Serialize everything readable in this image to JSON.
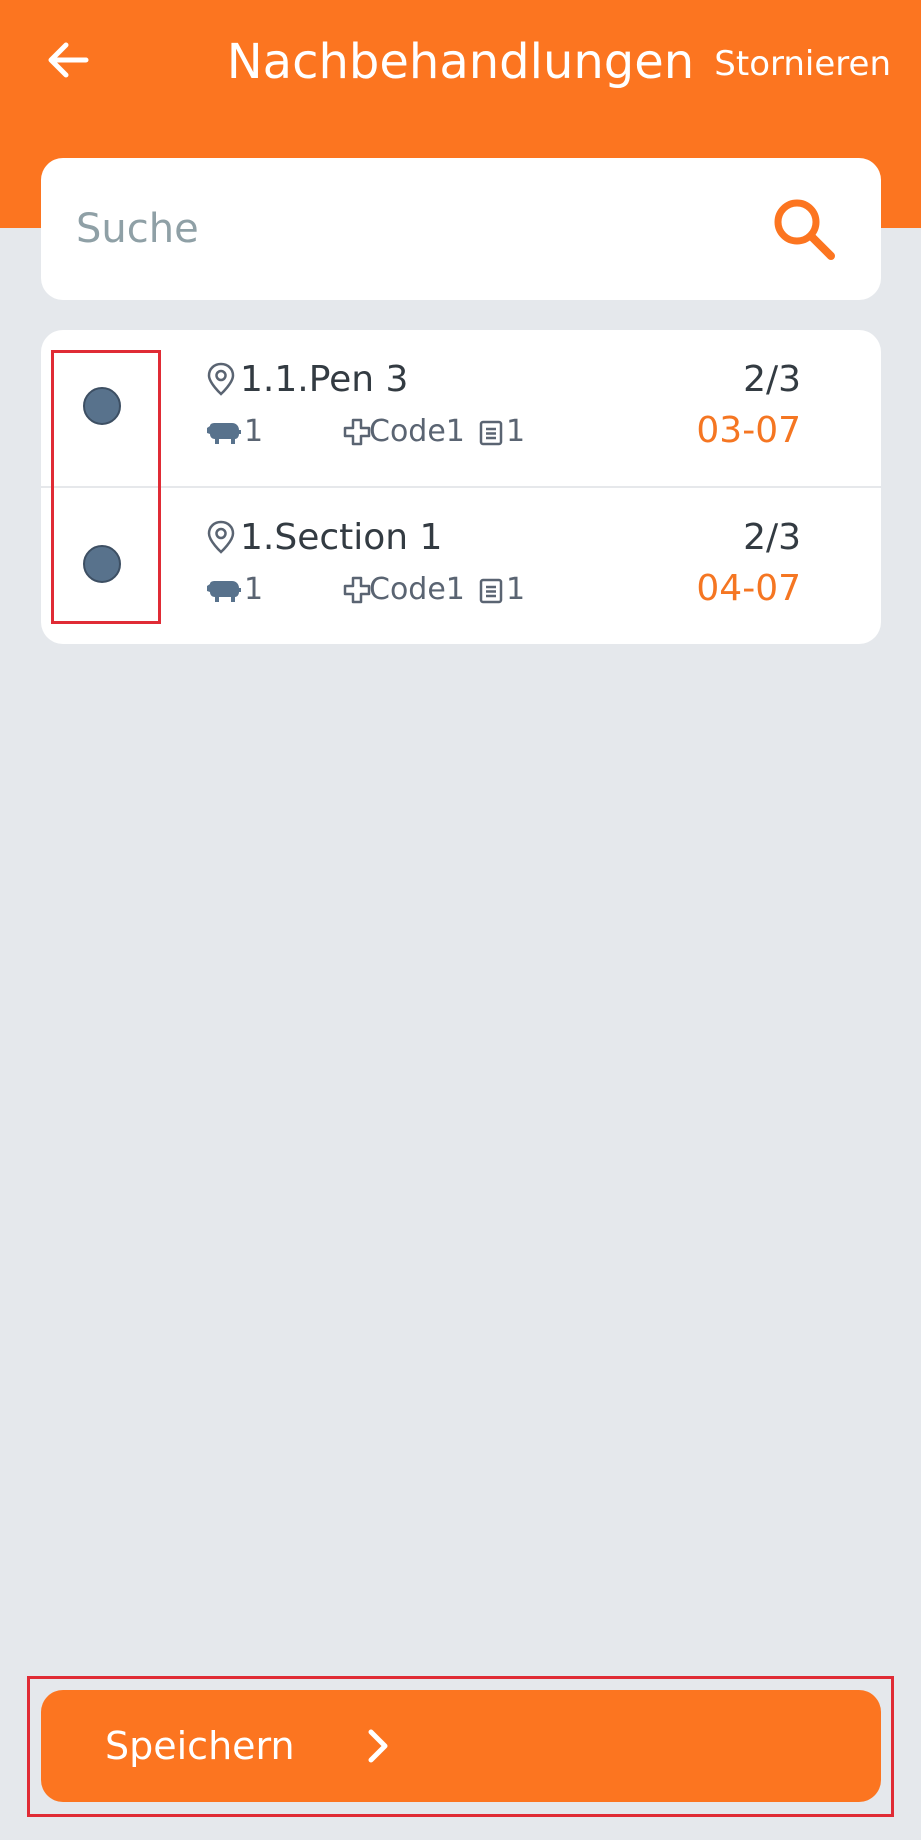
{
  "header": {
    "title": "Nachbehandlungen",
    "cancel_label": "Stornieren",
    "back_icon": "back-arrow-icon"
  },
  "search": {
    "placeholder": "Suche",
    "value": "",
    "icon": "search-icon"
  },
  "rows": [
    {
      "location": "1.1.Pen 3",
      "ratio": "2/3",
      "animals": "1",
      "code": "Code1",
      "notes": "1",
      "date": "03-07"
    },
    {
      "location": "1.Section 1",
      "ratio": "2/3",
      "animals": "1",
      "code": "Code1",
      "notes": "1",
      "date": "04-07"
    }
  ],
  "footer": {
    "save_label": "Speichern",
    "chevron_icon": "chevron-right-icon"
  },
  "colors": {
    "accent": "#fc7520",
    "date": "#f57622",
    "background": "#e5e8ec",
    "radio": "#58728c",
    "highlight": "#e02b35"
  }
}
